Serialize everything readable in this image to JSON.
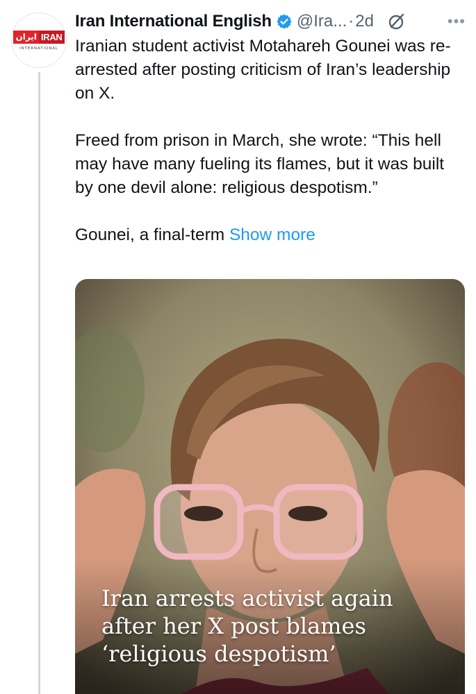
{
  "account": {
    "name": "Iran International English",
    "handle": "@Ira...",
    "separator": "·",
    "time": "2d",
    "avatar_fa": "ایران",
    "avatar_en": "IRAN",
    "avatar_sub": "INTERNATIONAL"
  },
  "icons": {
    "verified": "verified-badge-icon",
    "grok": "grok-icon",
    "more": "more-options-icon"
  },
  "tweet": {
    "paragraph1": "Iranian student activist Motahareh Gounei was re-arrested after posting criticism of Iran’s leadership on X.",
    "paragraph2": "Freed from prison in March, she wrote: “This hell may have many fueling its flames, but it was built by one devil alone: religious despotism.”",
    "paragraph3": "Gounei, a final-term",
    "show_more": "Show more"
  },
  "media": {
    "headline_line1": "Iran arrests activist again",
    "headline_line2": "after her X post blames",
    "headline_line3": "‘religious despotism’"
  },
  "colors": {
    "accent": "#1d9bf0",
    "text": "#0f1419",
    "secondary": "#536471",
    "brand_red": "#e0242b"
  }
}
